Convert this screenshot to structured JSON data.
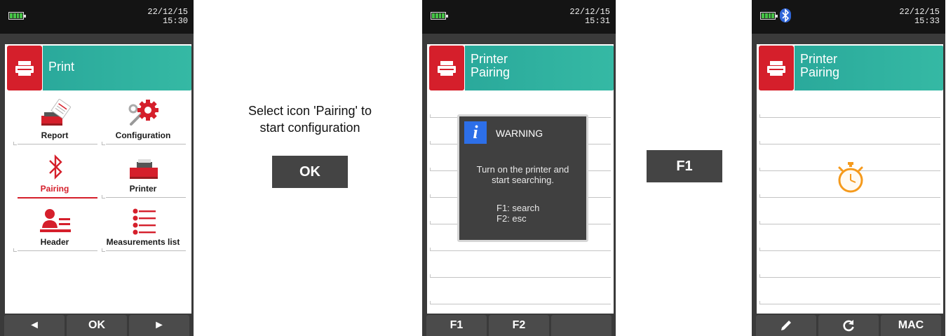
{
  "colors": {
    "brand_red": "#d51f2b",
    "header_teal": "#2aa99b",
    "timer_orange": "#f59a1c"
  },
  "screen1": {
    "date": "22/12/15",
    "time": "15:30",
    "title": "Print",
    "menu": [
      {
        "label": "Report",
        "icon": "report-printer-icon"
      },
      {
        "label": "Configuration",
        "icon": "configuration-gear-icon"
      },
      {
        "label": "Pairing",
        "icon": "bluetooth-icon",
        "selected": true
      },
      {
        "label": "Printer",
        "icon": "printer-icon"
      },
      {
        "label": "Header",
        "icon": "header-person-icon"
      },
      {
        "label": "Measurements list",
        "icon": "measurements-list-icon"
      }
    ],
    "softkeys": {
      "left": "◄",
      "center": "OK",
      "right": "►"
    }
  },
  "step1": {
    "line1": "Select icon 'Pairing' to",
    "line2": "start configuration",
    "key": "OK"
  },
  "screen2": {
    "date": "22/12/15",
    "time": "15:31",
    "title_line1": "Printer",
    "title_line2": "Pairing",
    "dialog": {
      "title": "WARNING",
      "icon": "info-icon",
      "line1": "Turn on the printer and",
      "line2": "start searching.",
      "key1": "F1: search",
      "key2": "F2: esc"
    },
    "softkeys": {
      "k1": "F1",
      "k2": "F2",
      "k3": ""
    }
  },
  "step2": {
    "key": "F1"
  },
  "screen3": {
    "date": "22/12/15",
    "time": "15:33",
    "title_line1": "Printer",
    "title_line2": "Pairing",
    "status_icon": "stopwatch-icon",
    "softkeys": {
      "k1": "pencil-icon",
      "k2": "refresh-icon",
      "k3": "MAC"
    }
  }
}
